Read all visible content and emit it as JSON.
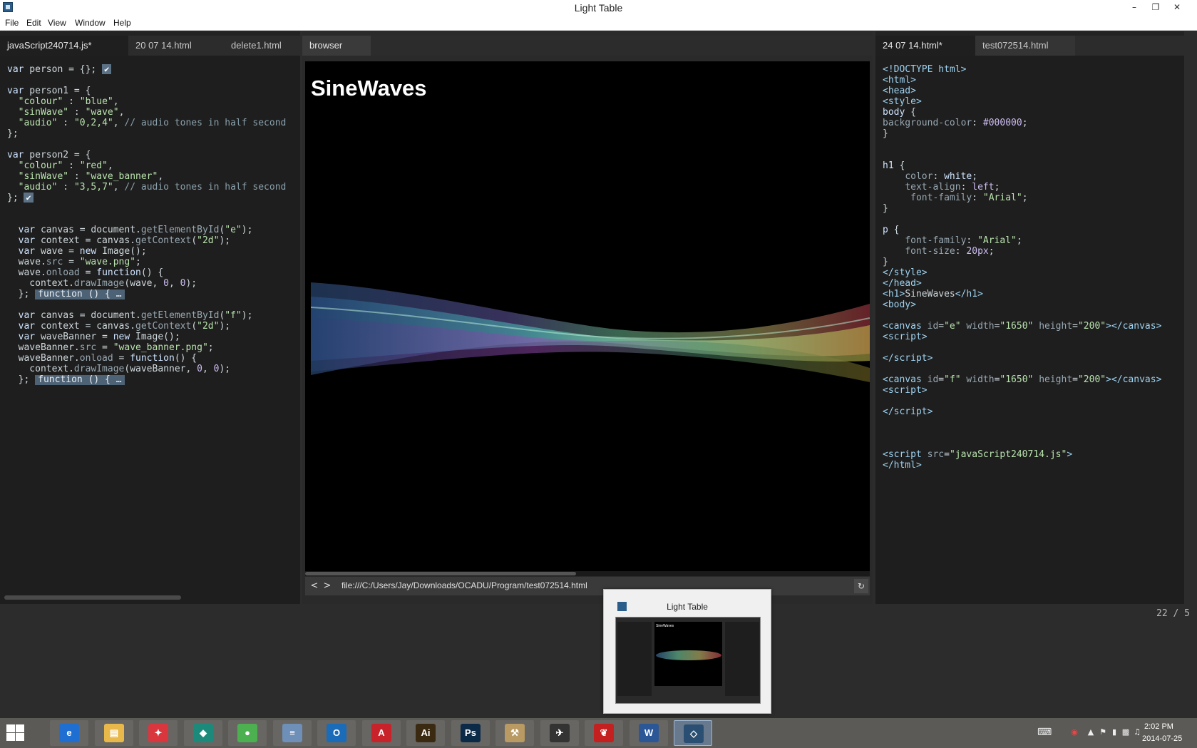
{
  "window": {
    "title": "Light Table",
    "minimize": "–",
    "maximize": "❐",
    "close": "✕"
  },
  "menu": [
    "File",
    "Edit",
    "View",
    "Window",
    "Help"
  ],
  "left_pane": {
    "tabs": [
      "javaScript240714.js*",
      "20 07 14.html",
      "delete1.html"
    ],
    "active_tab": 0
  },
  "middle_pane": {
    "tabs": [
      "browser"
    ],
    "active_tab": 0,
    "page_heading": "SineWaves",
    "url": "file:///C:/Users/Jay/Downloads/OCADU/Program/test072514.html",
    "back": "<",
    "forward": ">",
    "refresh": "↻"
  },
  "right_pane": {
    "tabs": [
      "24 07 14.html*",
      "test072514.html"
    ],
    "active_tab": 0
  },
  "status": {
    "counter": "22 / 5"
  },
  "thumbnail": {
    "title": "Light Table",
    "heading": "SineWaves"
  },
  "taskbar": {
    "apps": [
      {
        "name": "Internet Explorer",
        "glyph": "e",
        "color": "#1e6fd1"
      },
      {
        "name": "File Explorer",
        "glyph": "▤",
        "color": "#e8b84a"
      },
      {
        "name": "App 3",
        "glyph": "✦",
        "color": "#d9363e"
      },
      {
        "name": "App 4",
        "glyph": "◆",
        "color": "#1c8a7a"
      },
      {
        "name": "Chrome",
        "glyph": "●",
        "color": "#4caf50"
      },
      {
        "name": "Calculator",
        "glyph": "≡",
        "color": "#6d8fb8"
      },
      {
        "name": "Outlook",
        "glyph": "O",
        "color": "#1a6bb8"
      },
      {
        "name": "Autodesk",
        "glyph": "A",
        "color": "#c8222a"
      },
      {
        "name": "Illustrator",
        "glyph": "Ai",
        "color": "#3a2a12"
      },
      {
        "name": "Photoshop",
        "glyph": "Ps",
        "color": "#0b2a47"
      },
      {
        "name": "Utility",
        "glyph": "⚒",
        "color": "#b89a62"
      },
      {
        "name": "Rhino",
        "glyph": "✈",
        "color": "#333333"
      },
      {
        "name": "Acrobat",
        "glyph": "❦",
        "color": "#c3201f"
      },
      {
        "name": "Word",
        "glyph": "W",
        "color": "#2b5797"
      },
      {
        "name": "Light Table",
        "glyph": "◇",
        "color": "#2a4f72"
      }
    ],
    "current_app": 14,
    "clock_time": "2:02 PM",
    "clock_date": "2014-07-25"
  }
}
